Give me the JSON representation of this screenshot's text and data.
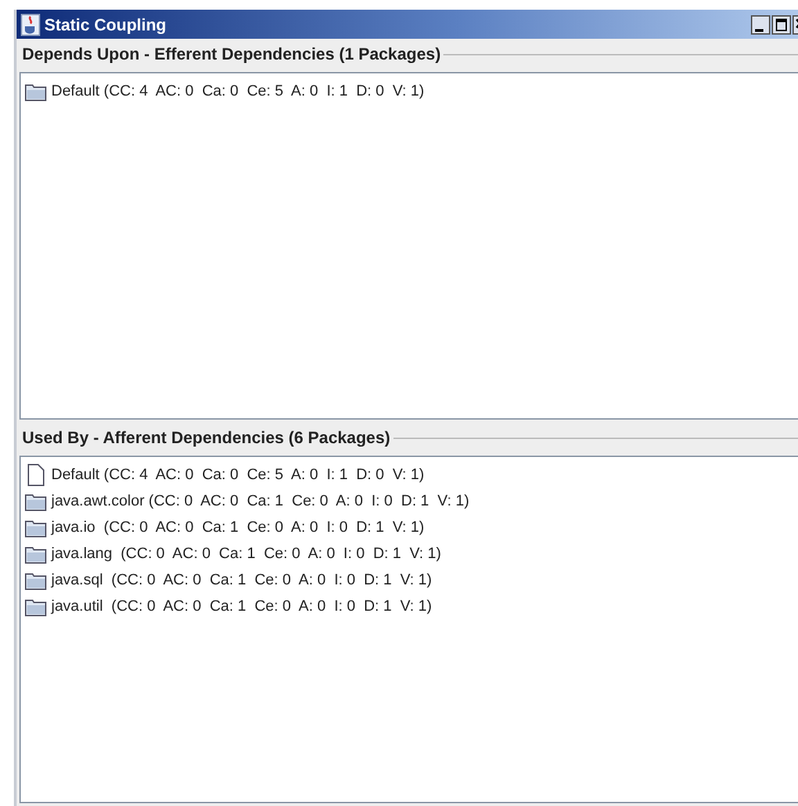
{
  "window": {
    "title": "Static Coupling"
  },
  "sections": [
    {
      "title": "Depends Upon - Efferent Dependencies (1 Packages)",
      "items": [
        {
          "kind": "folder",
          "label": "Default (CC: 4  AC: 0  Ca: 0  Ce: 5  A: 0  I: 1  D: 0  V: 1)"
        }
      ]
    },
    {
      "title": "Used By - Afferent Dependencies (6 Packages)",
      "items": [
        {
          "kind": "file",
          "label": "Default (CC: 4  AC: 0  Ca: 0  Ce: 5  A: 0  I: 1  D: 0  V: 1)"
        },
        {
          "kind": "folder",
          "label": "java.awt.color (CC: 0  AC: 0  Ca: 1  Ce: 0  A: 0  I: 0  D: 1  V: 1)"
        },
        {
          "kind": "folder",
          "label": "java.io  (CC: 0  AC: 0  Ca: 1  Ce: 0  A: 0  I: 0  D: 1  V: 1)"
        },
        {
          "kind": "folder",
          "label": "java.lang  (CC: 0  AC: 0  Ca: 1  Ce: 0  A: 0  I: 0  D: 1  V: 1)"
        },
        {
          "kind": "folder",
          "label": "java.sql  (CC: 0  AC: 0  Ca: 1  Ce: 0  A: 0  I: 0  D: 1  V: 1)"
        },
        {
          "kind": "folder",
          "label": "java.util  (CC: 0  AC: 0  Ca: 1  Ce: 0  A: 0  I: 0  D: 1  V: 1)"
        }
      ]
    }
  ]
}
